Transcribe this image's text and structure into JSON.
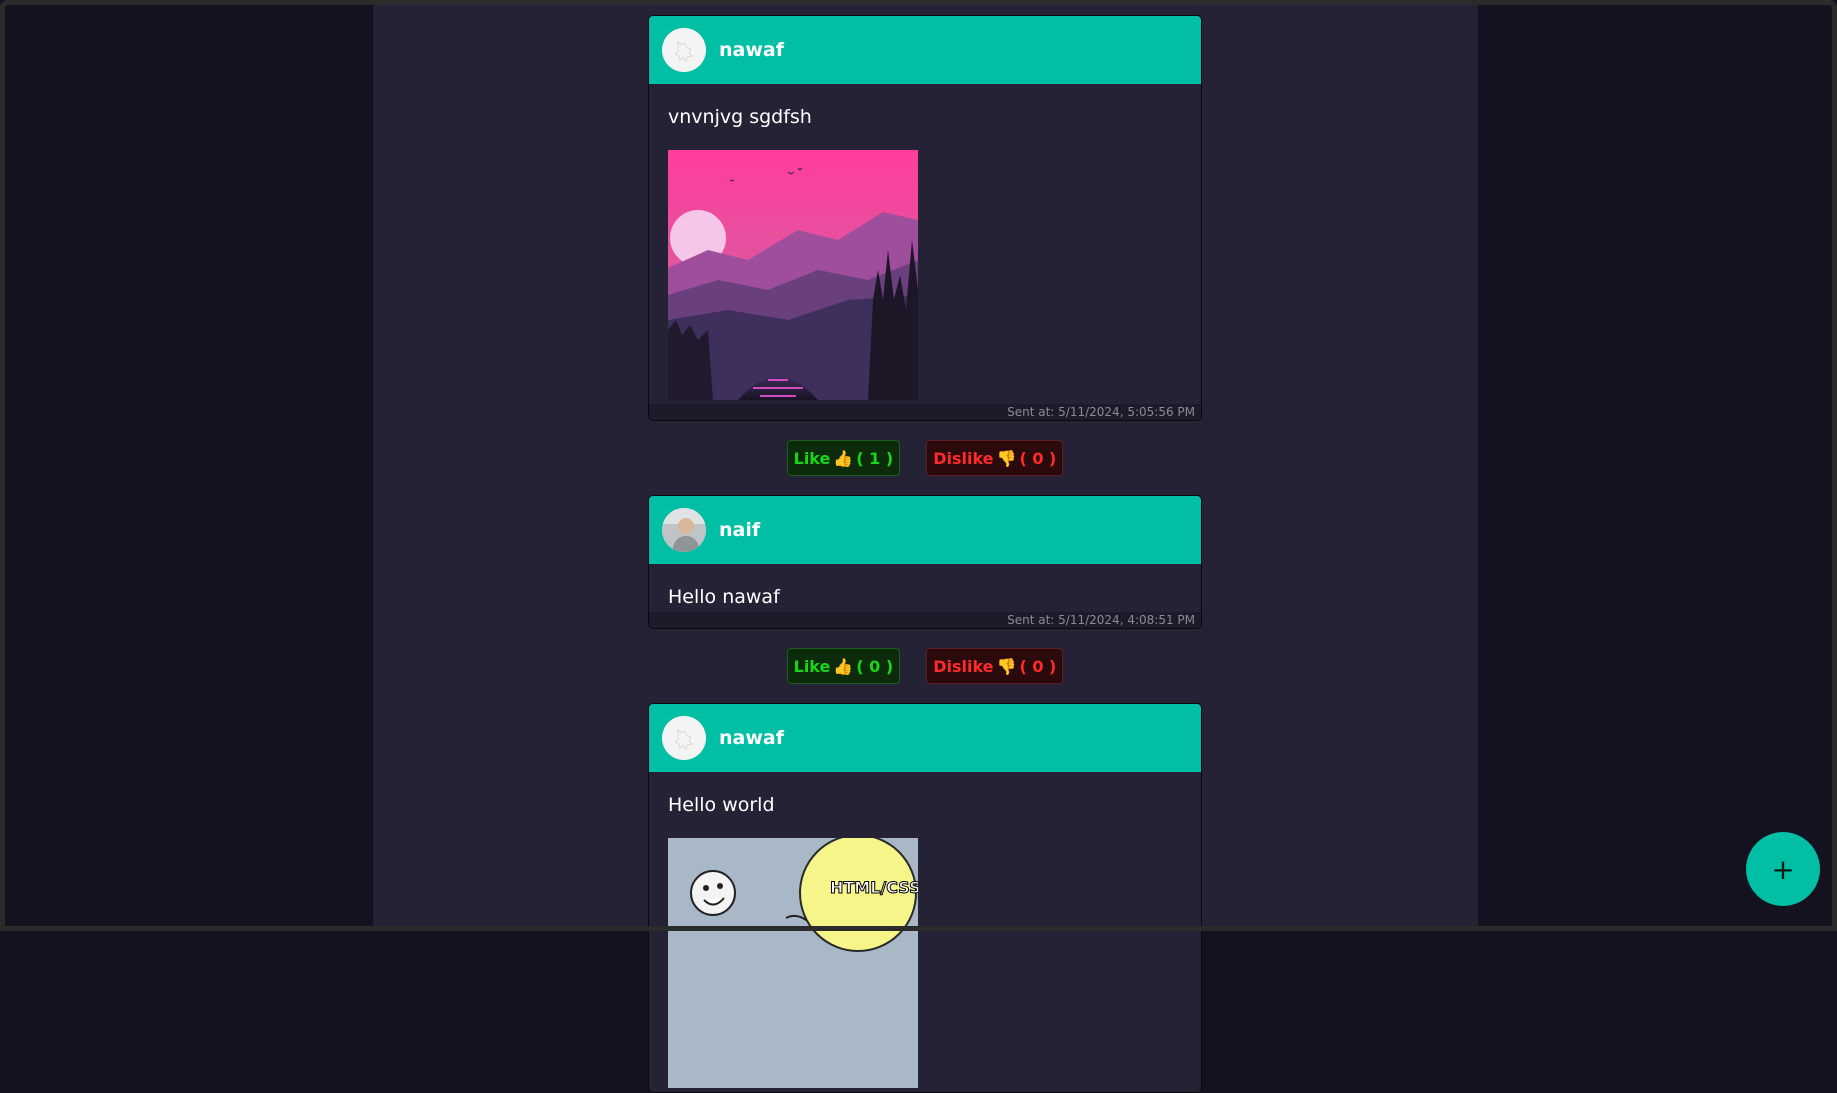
{
  "posts": [
    {
      "username": "nawaf",
      "text": "vnvnjvg sgdfsh",
      "has_image": true,
      "image_kind": "landscape",
      "sent_at": "Sent at: 5/11/2024, 5:05:56 PM",
      "like_label": "Like",
      "like_count": "( 1 )",
      "dislike_label": "Dislike",
      "dislike_count": "( 0 )"
    },
    {
      "username": "naif",
      "text": "Hello nawaf",
      "has_image": false,
      "sent_at": "Sent at: 5/11/2024, 4:08:51 PM",
      "like_label": "Like",
      "like_count": "( 0 )",
      "dislike_label": "Dislike",
      "dislike_count": "( 0 )"
    },
    {
      "username": "nawaf",
      "text": "Hello world",
      "has_image": true,
      "image_kind": "meme",
      "image_caption": "HTML/CSS"
    }
  ],
  "fab": {
    "label": "+"
  },
  "icons": {
    "thumb_up": "thumbs-up-icon",
    "thumb_down": "thumbs-down-icon",
    "add": "plus-icon"
  },
  "colors": {
    "accent": "#00bfa5",
    "page_bg": "#15121f",
    "column_bg": "#262236",
    "like": "#19d619",
    "dislike": "#ff2a2a"
  }
}
